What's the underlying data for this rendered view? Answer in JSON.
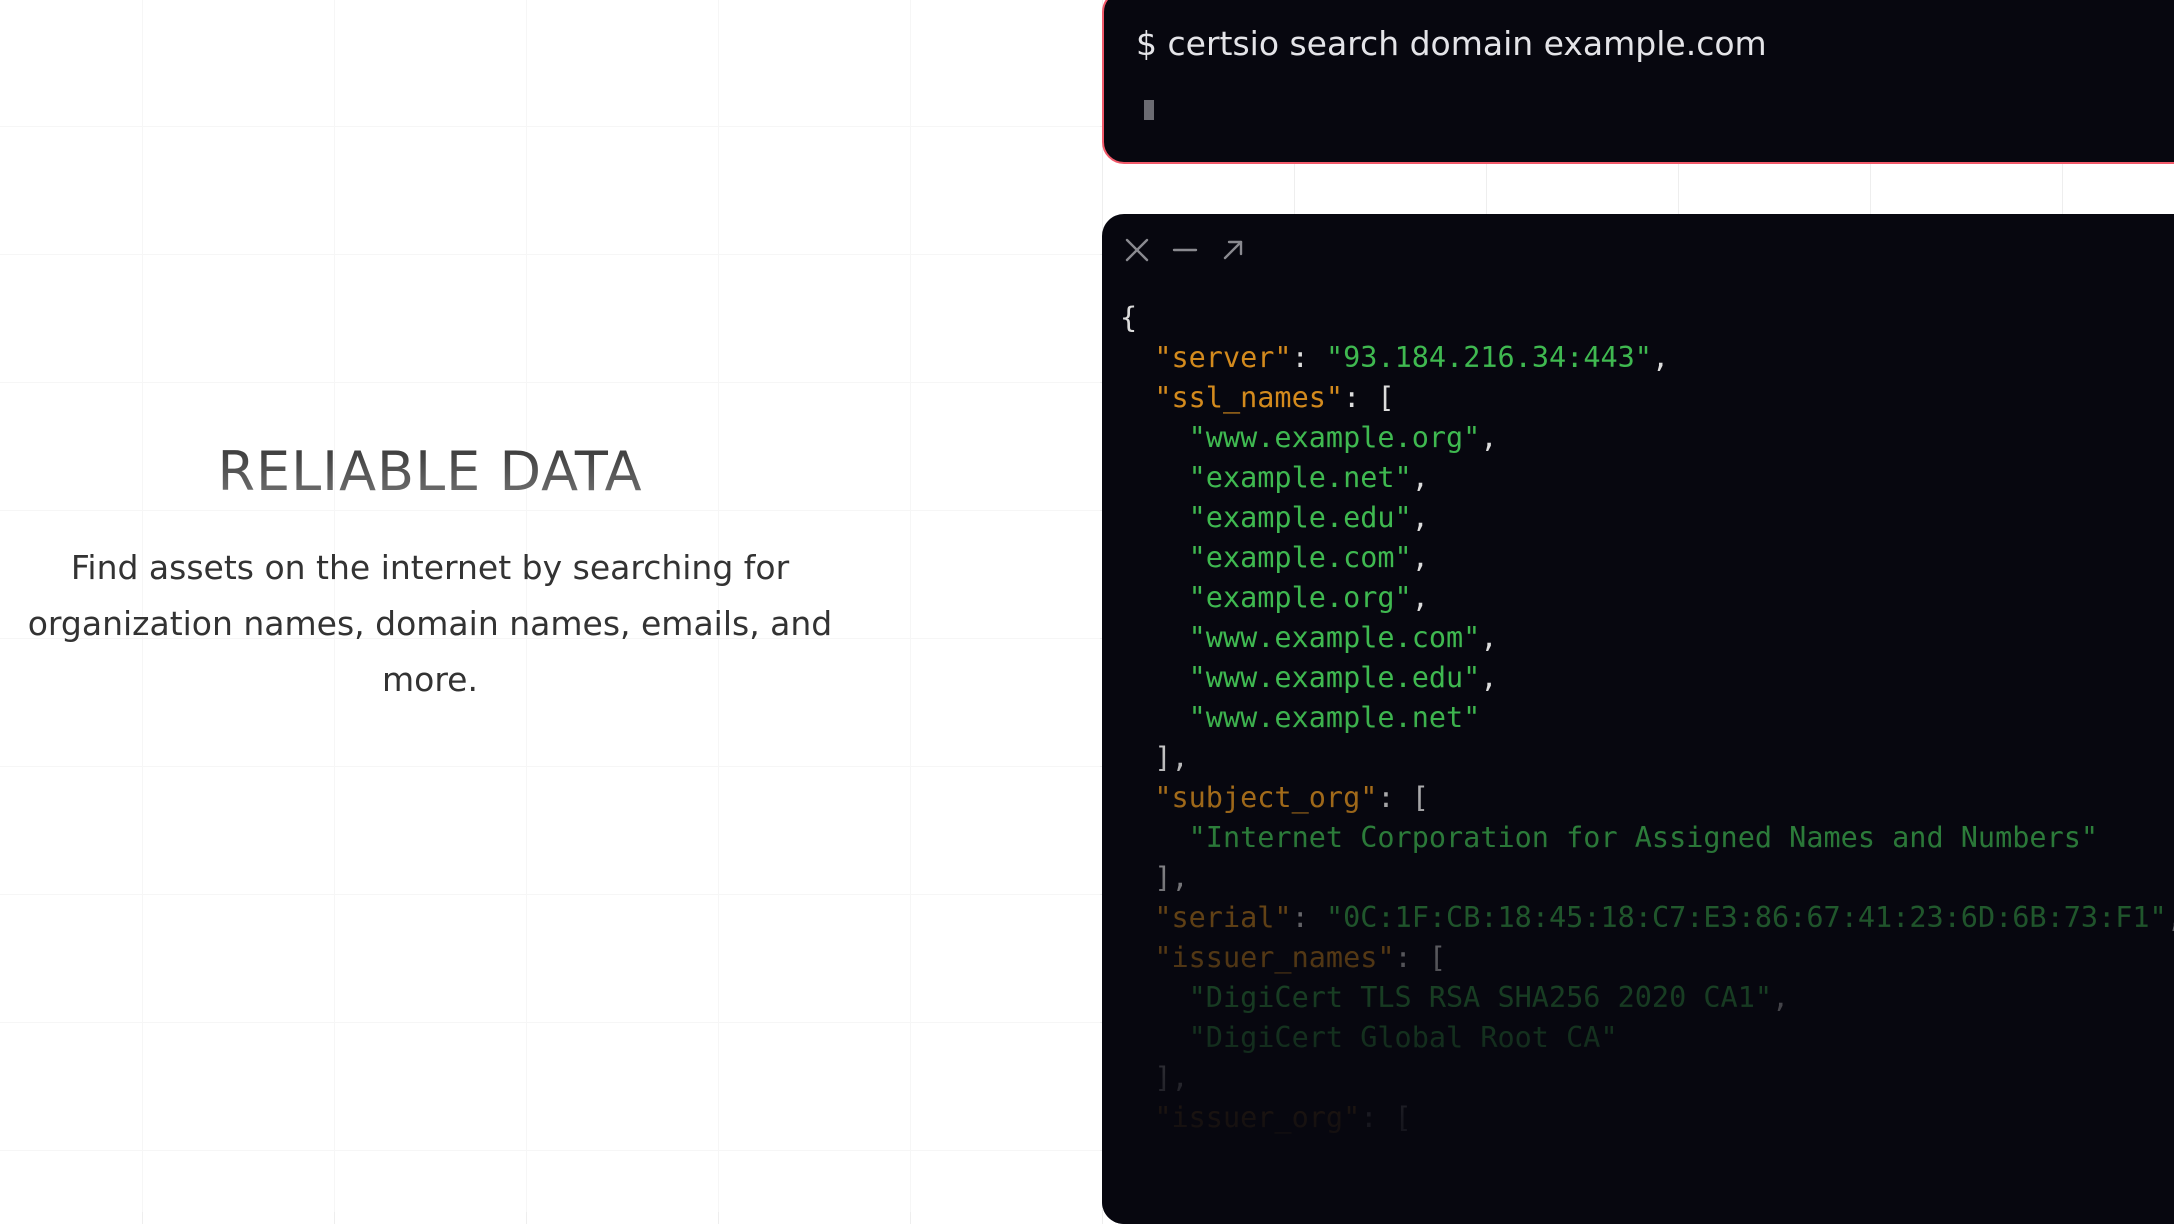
{
  "hero": {
    "title": "RELIABLE DATA",
    "description": "Find assets on the internet by searching for organization names, domain names, emails, and more."
  },
  "terminal": {
    "prompt": "$",
    "command": "certsio search domain example.com"
  },
  "output_window": {
    "controls": [
      "close-icon",
      "minimize-icon",
      "expand-icon"
    ],
    "lines": [
      {
        "indent": "",
        "parts": [
          {
            "t": "p",
            "v": "{"
          }
        ]
      },
      {
        "indent": "  ",
        "parts": [
          {
            "t": "k",
            "v": "\"server\""
          },
          {
            "t": "p",
            "v": ": "
          },
          {
            "t": "s",
            "v": "\"93.184.216.34:443\""
          },
          {
            "t": "p",
            "v": ","
          }
        ]
      },
      {
        "indent": "  ",
        "parts": [
          {
            "t": "k",
            "v": "\"ssl_names\""
          },
          {
            "t": "p",
            "v": ": ["
          }
        ]
      },
      {
        "indent": "    ",
        "parts": [
          {
            "t": "s",
            "v": "\"www.example.org\""
          },
          {
            "t": "p",
            "v": ","
          }
        ]
      },
      {
        "indent": "    ",
        "parts": [
          {
            "t": "s",
            "v": "\"example.net\""
          },
          {
            "t": "p",
            "v": ","
          }
        ]
      },
      {
        "indent": "    ",
        "parts": [
          {
            "t": "s",
            "v": "\"example.edu\""
          },
          {
            "t": "p",
            "v": ","
          }
        ]
      },
      {
        "indent": "    ",
        "parts": [
          {
            "t": "s",
            "v": "\"example.com\""
          },
          {
            "t": "p",
            "v": ","
          }
        ]
      },
      {
        "indent": "    ",
        "parts": [
          {
            "t": "s",
            "v": "\"example.org\""
          },
          {
            "t": "p",
            "v": ","
          }
        ]
      },
      {
        "indent": "    ",
        "parts": [
          {
            "t": "s",
            "v": "\"www.example.com\""
          },
          {
            "t": "p",
            "v": ","
          }
        ]
      },
      {
        "indent": "    ",
        "parts": [
          {
            "t": "s",
            "v": "\"www.example.edu\""
          },
          {
            "t": "p",
            "v": ","
          }
        ]
      },
      {
        "indent": "    ",
        "parts": [
          {
            "t": "s",
            "v": "\"www.example.net\""
          }
        ]
      },
      {
        "indent": "  ",
        "parts": [
          {
            "t": "p",
            "v": "],"
          }
        ]
      },
      {
        "indent": "  ",
        "parts": [
          {
            "t": "k",
            "v": "\"subject_org\""
          },
          {
            "t": "p",
            "v": ": ["
          }
        ]
      },
      {
        "indent": "    ",
        "parts": [
          {
            "t": "s",
            "v": "\"Internet Corporation for Assigned Names and Numbers\""
          }
        ]
      },
      {
        "indent": "  ",
        "parts": [
          {
            "t": "p",
            "v": "],"
          }
        ]
      },
      {
        "indent": "  ",
        "parts": [
          {
            "t": "k",
            "v": "\"serial\""
          },
          {
            "t": "p",
            "v": ": "
          },
          {
            "t": "s",
            "v": "\"0C:1F:CB:18:45:18:C7:E3:86:67:41:23:6D:6B:73:F1\""
          },
          {
            "t": "p",
            "v": ","
          }
        ]
      },
      {
        "indent": "  ",
        "parts": [
          {
            "t": "k",
            "v": "\"issuer_names\""
          },
          {
            "t": "p",
            "v": ": ["
          }
        ]
      },
      {
        "indent": "    ",
        "parts": [
          {
            "t": "s",
            "v": "\"DigiCert TLS RSA SHA256 2020 CA1\""
          },
          {
            "t": "p",
            "v": ","
          }
        ]
      },
      {
        "indent": "    ",
        "parts": [
          {
            "t": "s",
            "v": "\"DigiCert Global Root CA\""
          }
        ]
      },
      {
        "indent": "  ",
        "parts": [
          {
            "t": "p",
            "v": "],"
          }
        ]
      },
      {
        "indent": "  ",
        "parts": [
          {
            "t": "k",
            "v": "\"issuer_org\""
          },
          {
            "t": "p",
            "v": ": ["
          }
        ]
      }
    ]
  }
}
